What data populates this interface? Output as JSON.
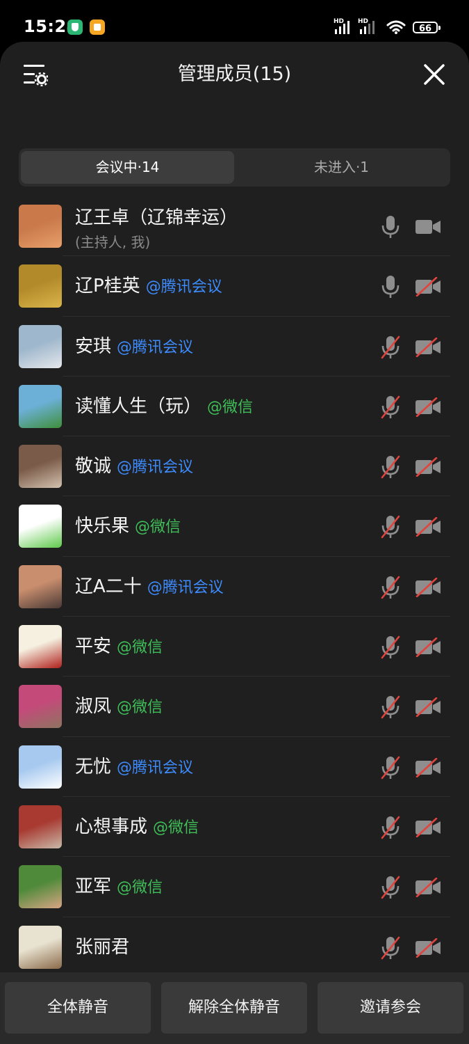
{
  "status_bar": {
    "time": "15:24",
    "hd1": "HD",
    "hd2": "HD",
    "battery": "66",
    "icons": [
      "shield-app-icon",
      "notes-app-icon",
      "signal-icon",
      "signal-icon",
      "wifi-icon",
      "battery-icon"
    ]
  },
  "header": {
    "title": "管理成员(15)",
    "icons": [
      "member-settings-icon",
      "close-icon"
    ]
  },
  "tabs": [
    {
      "label": "会议中·14",
      "active": true
    },
    {
      "label": "未进入·1",
      "active": false
    }
  ],
  "members": [
    {
      "name": "辽王卓（辽锦幸运）",
      "tag": "",
      "tag_type": "",
      "sub": "(主持人, 我)",
      "mic_on": true,
      "cam_on": true,
      "avatar_colors": [
        "#c9794a",
        "#e8a06a"
      ]
    },
    {
      "name": "辽P桂英",
      "tag": "@腾讯会议",
      "tag_type": "tencent",
      "sub": "",
      "mic_on": true,
      "cam_on": false,
      "avatar_colors": [
        "#b38a2a",
        "#d9b54a"
      ]
    },
    {
      "name": "安琪",
      "tag": "@腾讯会议",
      "tag_type": "tencent",
      "sub": "",
      "mic_on": false,
      "cam_on": false,
      "avatar_colors": [
        "#9fb7cc",
        "#e5e8ec"
      ]
    },
    {
      "name": "读懂人生（玩）",
      "tag": "@微信",
      "tag_type": "wechat",
      "sub": "",
      "mic_on": false,
      "cam_on": false,
      "avatar_colors": [
        "#6cb0d8",
        "#3f8f3a"
      ]
    },
    {
      "name": "敬诚",
      "tag": "@腾讯会议",
      "tag_type": "tencent",
      "sub": "",
      "mic_on": false,
      "cam_on": false,
      "avatar_colors": [
        "#7a5a48",
        "#d3c2b0"
      ]
    },
    {
      "name": "快乐果",
      "tag": "@微信",
      "tag_type": "wechat",
      "sub": "",
      "mic_on": false,
      "cam_on": false,
      "avatar_colors": [
        "#ffffff",
        "#5ec94a"
      ]
    },
    {
      "name": "辽A二十",
      "tag": "@腾讯会议",
      "tag_type": "tencent",
      "sub": "",
      "mic_on": false,
      "cam_on": false,
      "avatar_colors": [
        "#c98e6e",
        "#4a3a36"
      ]
    },
    {
      "name": "平安",
      "tag": "@微信",
      "tag_type": "wechat",
      "sub": "",
      "mic_on": false,
      "cam_on": false,
      "avatar_colors": [
        "#f5f0e0",
        "#b0201c"
      ]
    },
    {
      "name": "淑凤",
      "tag": "@微信",
      "tag_type": "wechat",
      "sub": "",
      "mic_on": false,
      "cam_on": false,
      "avatar_colors": [
        "#c44a7a",
        "#8e7460"
      ]
    },
    {
      "name": "无忧",
      "tag": "@腾讯会议",
      "tag_type": "tencent",
      "sub": "",
      "mic_on": false,
      "cam_on": false,
      "avatar_colors": [
        "#a7c9ef",
        "#ffffff"
      ]
    },
    {
      "name": "心想事成",
      "tag": "@微信",
      "tag_type": "wechat",
      "sub": "",
      "mic_on": false,
      "cam_on": false,
      "avatar_colors": [
        "#a83a32",
        "#c9b9a8"
      ]
    },
    {
      "name": "亚军",
      "tag": "@微信",
      "tag_type": "wechat",
      "sub": "",
      "mic_on": false,
      "cam_on": false,
      "avatar_colors": [
        "#4f8a3a",
        "#d9a584"
      ]
    },
    {
      "name": "张丽君",
      "tag": "",
      "tag_type": "",
      "sub": "",
      "mic_on": false,
      "cam_on": false,
      "avatar_colors": [
        "#e8e2d0",
        "#8a6a4a"
      ]
    }
  ],
  "bottom_buttons": [
    "全体静音",
    "解除全体静音",
    "邀请参会"
  ],
  "colors": {
    "tencent_tag": "#3d8bfd",
    "wechat_tag": "#3fbf58",
    "muted_red": "#e0443e",
    "icon_gray": "#8e8e8e"
  }
}
